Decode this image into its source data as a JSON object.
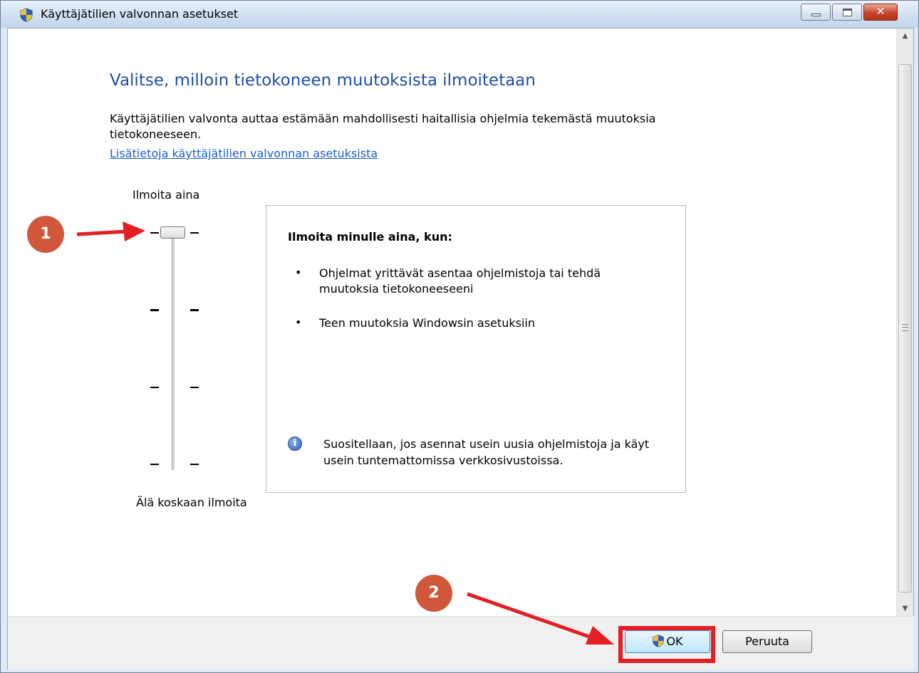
{
  "window": {
    "title": "Käyttäjätilien valvonnan asetukset"
  },
  "content": {
    "heading": "Valitse, milloin tietokoneen muutoksista ilmoitetaan",
    "description": "Käyttäjätilien valvonta auttaa estämään mahdollisesti haitallisia ohjelmia tekemästä muutoksia tietokoneeseen.",
    "link": "Lisätietoja käyttäjätilien valvonnan asetuksista"
  },
  "slider": {
    "top_label": "Ilmoita aina",
    "bottom_label": "Älä koskaan ilmoita",
    "levels": 4,
    "selected_level": 4
  },
  "info": {
    "title": "Ilmoita minulle aina, kun:",
    "bullets": [
      "Ohjelmat yrittävät asentaa ohjelmistoja tai tehdä muutoksia tietokoneeseeni",
      "Teen muutoksia Windowsin asetuksiin"
    ],
    "bullet_char": "•",
    "note": "Suositellaan, jos asennat usein uusia ohjelmistoja ja käyt usein tuntemattomissa verkkosivustoissa."
  },
  "buttons": {
    "ok": "OK",
    "cancel": "Peruuta"
  },
  "annotations": {
    "step1": "1",
    "step2": "2",
    "color": "#d0573a",
    "arrow_color": "#e31e24"
  },
  "icons": {
    "title": "uac-shield-icon",
    "info": "info-icon"
  }
}
